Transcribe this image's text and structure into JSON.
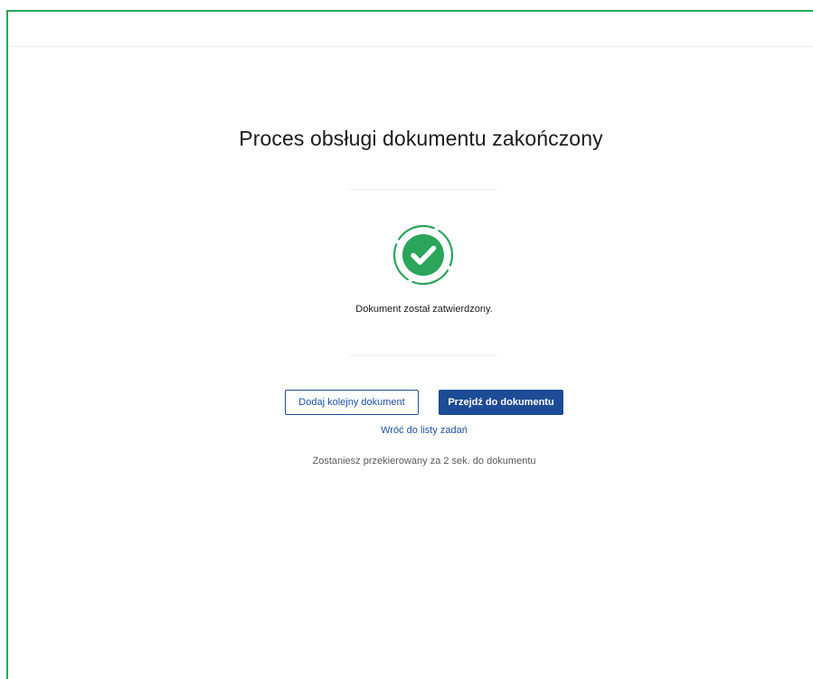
{
  "page": {
    "title": "Proces obsługi dokumentu zakończony",
    "status_icon": "check-circle-icon",
    "message": "Dokument został zatwierdzony.",
    "accent_color": "#2aa55a",
    "primary_color": "#1d4b95"
  },
  "actions": {
    "add_document_label": "Dodaj kolejny dokument",
    "go_to_document_label": "Przejdź do dokumentu",
    "back_to_tasks_label": "Wróć do listy zadań"
  },
  "redirect": {
    "text": "Zostaniesz przekierowany za 2 sek. do dokumentu"
  }
}
